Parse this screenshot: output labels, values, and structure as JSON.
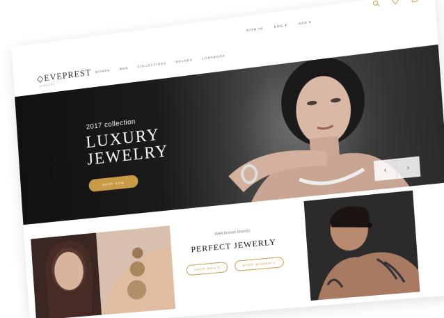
{
  "header": {
    "logo": "EVEPREST",
    "logo_sub": "JEWELRY",
    "nav": [
      "WOMEN",
      "MEN",
      "COLLECTIONS",
      "BRANDS",
      "LOOKBOOK"
    ],
    "top_links": [
      "SIGN IN",
      "ENG",
      "USD"
    ],
    "icons": [
      "search-icon",
      "diamond-icon",
      "cart-icon"
    ]
  },
  "hero": {
    "eyebrow": "2017 collection",
    "title_line1": "LUXURY",
    "title_line2": "JEWELRY",
    "button": "SHOP NOW",
    "prev": "‹",
    "next": "›"
  },
  "promo": {
    "subtitle": "Well-known brands",
    "title": "PERFECT JEWERLY",
    "btn_men": "SHOP MEN'S",
    "btn_women": "SHOP WOMEN'S"
  },
  "colors": {
    "accent": "#c99b46",
    "hero_bg": "#151515"
  }
}
